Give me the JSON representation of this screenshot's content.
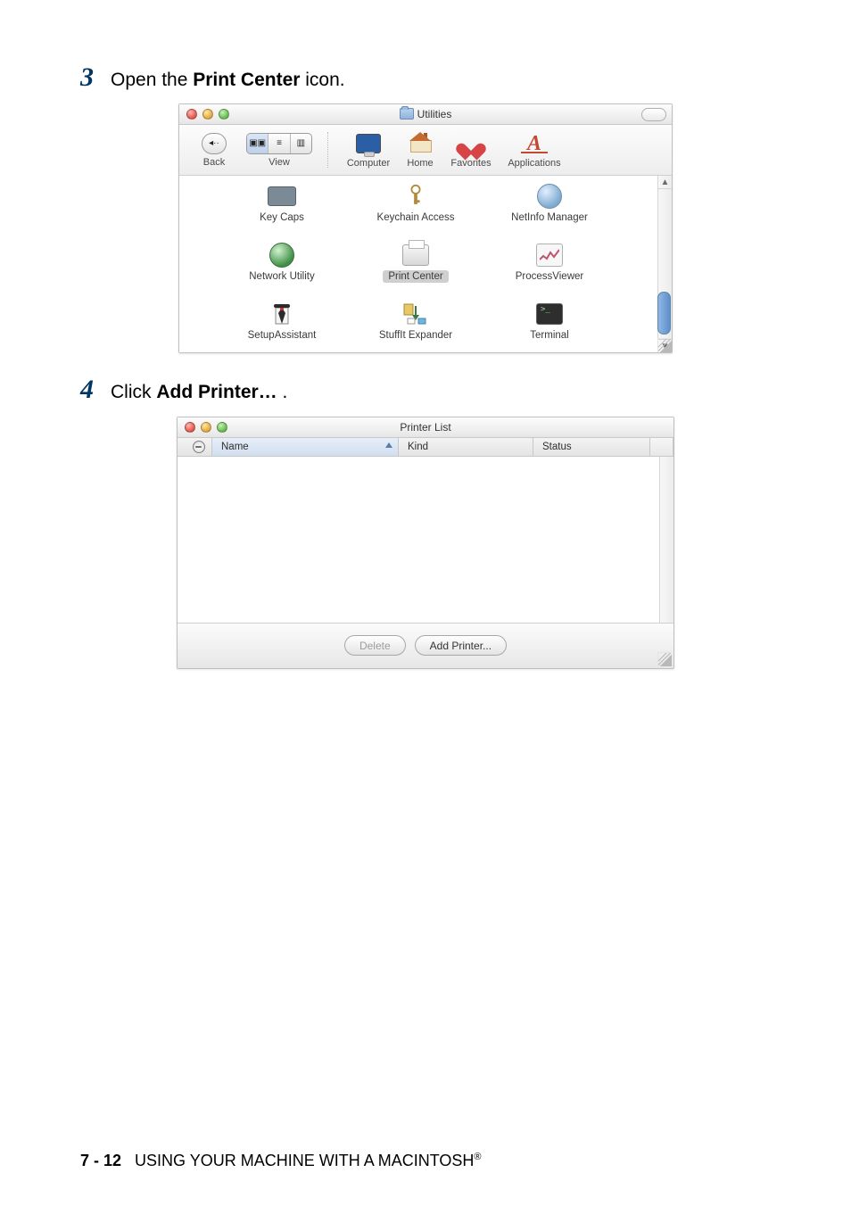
{
  "steps": {
    "s3": {
      "num": "3",
      "pre": "Open the ",
      "bold": "Print Center",
      "post": " icon."
    },
    "s4": {
      "num": "4",
      "pre": "Click ",
      "bold": "Add Printer…",
      "post": " ."
    }
  },
  "utilities_window": {
    "title": "Utilities",
    "toolbar": {
      "back": "Back",
      "view": "View",
      "computer": "Computer",
      "home": "Home",
      "favorites": "Favorites",
      "applications": "Applications"
    },
    "items": [
      "Key Caps",
      "Keychain Access",
      "NetInfo Manager",
      "Network Utility",
      "Print Center",
      "ProcessViewer",
      "SetupAssistant",
      "StuffIt Expander",
      "Terminal"
    ],
    "selected_index": 4
  },
  "printer_window": {
    "title": "Printer List",
    "columns": {
      "name": "Name",
      "kind": "Kind",
      "status": "Status"
    },
    "buttons": {
      "delete": "Delete",
      "add": "Add Printer..."
    }
  },
  "footer": {
    "page": "7 - 12",
    "chapter": "USING YOUR MACHINE WITH A MACINTOSH",
    "reg": "®"
  }
}
